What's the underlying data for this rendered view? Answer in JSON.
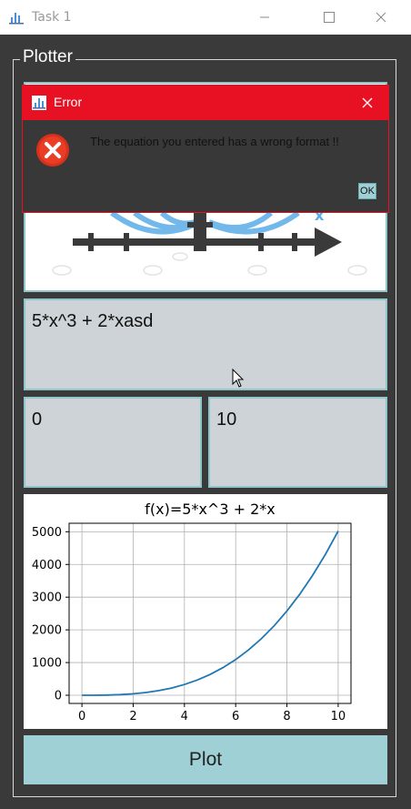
{
  "window": {
    "title": "Task 1",
    "icon": "matplotlib-logo-icon"
  },
  "group": {
    "title": "Plotter"
  },
  "inputs": {
    "equation": "5*x^3 + 2*xasd",
    "min": "0",
    "max": "10"
  },
  "plot_button": {
    "label": "Plot"
  },
  "dialog": {
    "title": "Error",
    "message": "The equation you entered has a wrong format !!",
    "ok_label": "OK",
    "accent_color": "#e81123"
  },
  "colors": {
    "field_border": "#8fc6cc",
    "field_bg": "#cdd3d6",
    "button_bg": "#9fd0d6",
    "series": "#1f77b4"
  },
  "chart_data": {
    "type": "line",
    "title": "f(x)=5*x^3 + 2*x",
    "xlabel": "",
    "ylabel": "",
    "xlim": [
      -0.5,
      10.5
    ],
    "ylim": [
      -250,
      5260
    ],
    "xticks": [
      0,
      2,
      4,
      6,
      8,
      10
    ],
    "yticks": [
      0,
      1000,
      2000,
      3000,
      4000,
      5000
    ],
    "grid": true,
    "series": [
      {
        "x": [
          0,
          0.5,
          1,
          1.5,
          2,
          2.5,
          3,
          3.5,
          4,
          4.5,
          5,
          5.5,
          6,
          6.5,
          7,
          7.5,
          8,
          8.5,
          9,
          9.5,
          10
        ],
        "values": [
          0,
          1.6,
          7,
          19.9,
          44,
          83.1,
          141,
          221.4,
          328,
          464.6,
          635,
          843,
          1092,
          1386,
          1729,
          2124,
          2576,
          3087,
          3663,
          4306,
          5020
        ]
      }
    ]
  }
}
